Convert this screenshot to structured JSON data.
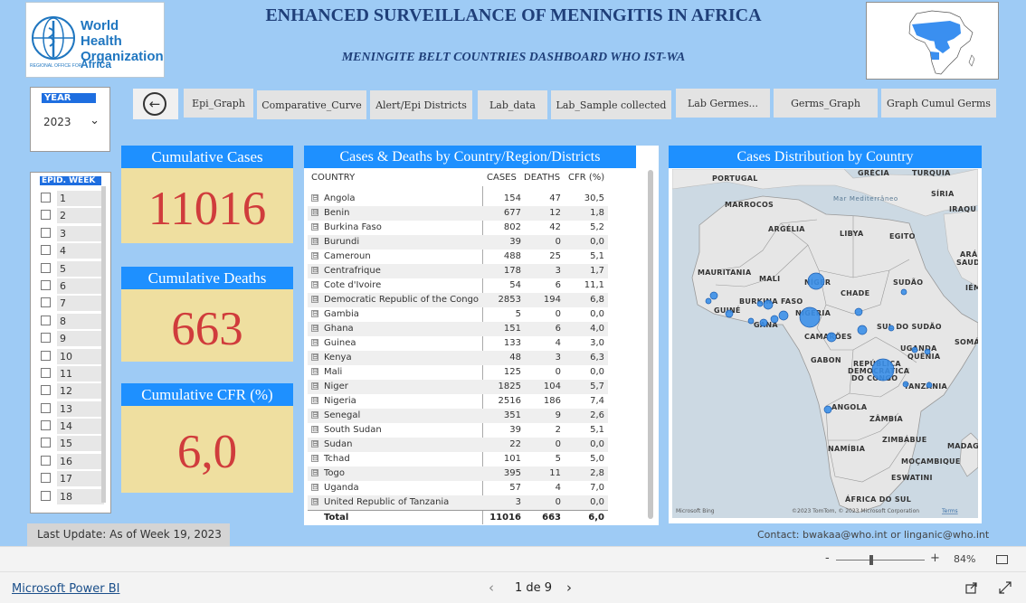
{
  "header": {
    "title": "ENHANCED SURVEILLANCE OF MENINGITIS IN AFRICA",
    "subtitle": "MENINGITE BELT COUNTRIES DASHBOARD  WHO IST-WA"
  },
  "logo": {
    "line1": "World Health",
    "line2": "Organization",
    "regional": "REGIONAL OFFICE FOR",
    "region": "Africa"
  },
  "filters": {
    "year_label": "YEAR",
    "year_value": "2023",
    "epid_label": "EPID. WEEK",
    "weeks": [
      "1",
      "2",
      "3",
      "4",
      "5",
      "6",
      "7",
      "8",
      "9",
      "10",
      "11",
      "12",
      "13",
      "14",
      "15",
      "16",
      "17",
      "18"
    ]
  },
  "nav": {
    "back_icon": "arrow-left-circle-icon",
    "buttons": [
      "Epi_Graph",
      "Comparative_Curve",
      "Alert/Epi Districts",
      "Lab_data",
      "Lab_Sample collected",
      "Lab Germes...",
      "Germs_Graph",
      "Graph Cumul Germs"
    ]
  },
  "kpis": {
    "cases_title": "Cumulative Cases",
    "cases_value": "11016",
    "deaths_title": "Cumulative Deaths",
    "deaths_value": "663",
    "cfr_title": "Cumulative CFR (%)",
    "cfr_value": "6,0"
  },
  "table": {
    "title": "Cases & Deaths by Country/Region/Districts",
    "columns": [
      "COUNTRY",
      "CASES",
      "DEATHS",
      "CFR (%)"
    ],
    "rows": [
      [
        "Angola",
        "154",
        "47",
        "30,5"
      ],
      [
        "Benin",
        "677",
        "12",
        "1,8"
      ],
      [
        "Burkina Faso",
        "802",
        "42",
        "5,2"
      ],
      [
        "Burundi",
        "39",
        "0",
        "0,0"
      ],
      [
        "Cameroun",
        "488",
        "25",
        "5,1"
      ],
      [
        "Centrafrique",
        "178",
        "3",
        "1,7"
      ],
      [
        "Cote d'Ivoire",
        "54",
        "6",
        "11,1"
      ],
      [
        "Democratic Republic of the Congo",
        "2853",
        "194",
        "6,8"
      ],
      [
        "Gambia",
        "5",
        "0",
        "0,0"
      ],
      [
        "Ghana",
        "151",
        "6",
        "4,0"
      ],
      [
        "Guinea",
        "133",
        "4",
        "3,0"
      ],
      [
        "Kenya",
        "48",
        "3",
        "6,3"
      ],
      [
        "Mali",
        "125",
        "0",
        "0,0"
      ],
      [
        "Niger",
        "1825",
        "104",
        "5,7"
      ],
      [
        "Nigeria",
        "2516",
        "186",
        "7,4"
      ],
      [
        "Senegal",
        "351",
        "9",
        "2,6"
      ],
      [
        "South Sudan",
        "39",
        "2",
        "5,1"
      ],
      [
        "Sudan",
        "22",
        "0",
        "0,0"
      ],
      [
        "Tchad",
        "101",
        "5",
        "5,0"
      ],
      [
        "Togo",
        "395",
        "11",
        "2,8"
      ],
      [
        "Uganda",
        "57",
        "4",
        "7,0"
      ],
      [
        "United Republic of Tanzania",
        "3",
        "0",
        "0,0"
      ]
    ],
    "total": [
      "Total",
      "11016",
      "663",
      "6,0"
    ]
  },
  "map": {
    "title": "Cases Distribution by Country",
    "labels": {
      "portugal": "PORTUGAL",
      "grecia": "GRÉCIA",
      "turquia": "TURQUIA",
      "siria": "SÍRIA",
      "iraque": "IRAQU",
      "mar": "Mar Mediterrâneo",
      "marrocos": "MARROCOS",
      "argelia": "ARGÉLIA",
      "libya": "LIBYA",
      "egito": "EGITO",
      "arabia1": "ARÁ",
      "arabia2": "SAUD",
      "mauritania": "MAURITANIA",
      "mali": "MALI",
      "niger": "NÍGER",
      "chade": "CHADE",
      "sudao": "SUDÃO",
      "iem": "IÉM",
      "burkina": "BURKINA FASO",
      "guine": "GUINÉ",
      "nigeria": "NIGÉRIA",
      "gana": "GANA",
      "sulsudao": "SUL DO SUDÃO",
      "somalia": "SOMÁ",
      "camaroes": "CAMARÕES",
      "uganda": "UGANDA",
      "quenia": "QUÊNIA",
      "gabon": "GABON",
      "rdc1": "REPÚBLICA",
      "rdc2": "DEMOCRÁTICA",
      "rdc3": "DO CONGO",
      "tanzania": "TANZÂNIA",
      "angola": "ANGOLA",
      "zambia": "ZÂMBIA",
      "zimbabue": "ZIMBÁBUE",
      "namibia": "NAMÍBIA",
      "madagascar": "MADAG",
      "mocambique": "MOÇAMBIQUE",
      "eswatini": "ESWATINI",
      "africadosul": "ÁFRICA DO SUL"
    },
    "attribution": "©2023 TomTom, © 2023 Microsoft Corporation",
    "terms": "Terms",
    "bing": "Microsoft Bing"
  },
  "footer": {
    "last_update": "Last Update:  As of Week 19, 2023",
    "contact": "Contact: bwakaa@who.int or linganic@who.int",
    "zoom": "84%",
    "powerbi": "Microsoft Power BI",
    "page": "1 de 9"
  }
}
